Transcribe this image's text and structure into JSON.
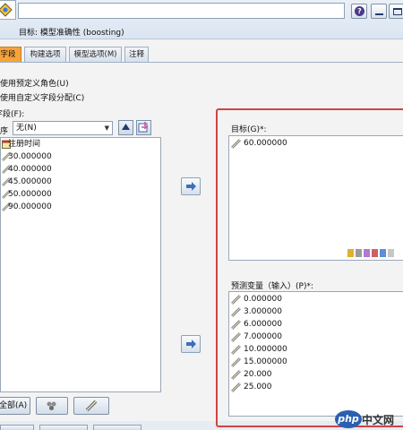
{
  "window": {
    "target_title": "目标: 模型准确性 (boosting)",
    "name_value": ""
  },
  "tabs": [
    {
      "label": "字段",
      "active": true
    },
    {
      "label": "构建选项",
      "active": false
    },
    {
      "label": "模型选项(M)",
      "active": false
    },
    {
      "label": "注释",
      "active": false
    }
  ],
  "left": {
    "radio_predefined": "使用预定义角色(U)",
    "radio_custom": "使用自定义字段分配(C)",
    "fields_label": "字段(F):",
    "sort_label": "序",
    "sort_value": "无(N)",
    "fields": [
      {
        "name": "注册时间",
        "icon": "calendar-icon"
      },
      {
        "name": "30.000000",
        "icon": "ruler-icon"
      },
      {
        "name": "40.000000",
        "icon": "ruler-icon"
      },
      {
        "name": "45.000000",
        "icon": "ruler-icon"
      },
      {
        "name": "50.000000",
        "icon": "ruler-icon"
      },
      {
        "name": "90.000000",
        "icon": "ruler-icon"
      }
    ],
    "all_button": "全部(A)"
  },
  "right": {
    "target_label": "目标(G)*:",
    "target_fields": [
      "60.000000"
    ],
    "predictor_label": "预测变量（输入）(P)*:",
    "predictor_fields": [
      "0.000000",
      "3.000000",
      "6.000000",
      "7.000000",
      "10.000000",
      "15.000000",
      "20.000",
      "25.000"
    ]
  },
  "colors": {
    "active_tab": "#f7a23c",
    "highlight_border": "#d04444",
    "window_band": "#dbe5f1"
  },
  "watermark": {
    "badge": "php",
    "text": "中文网"
  }
}
